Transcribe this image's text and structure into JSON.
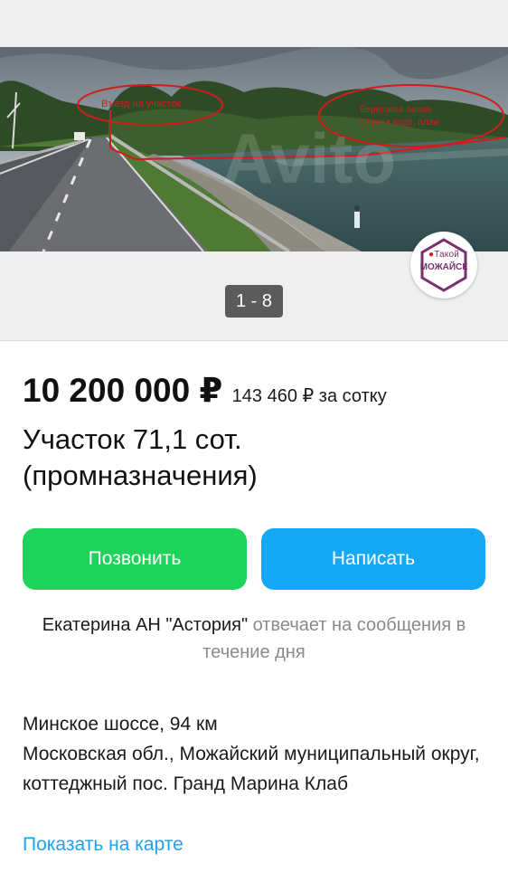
{
  "gallery": {
    "photo_annotations": {
      "left": "Въезд на участок",
      "right_line1": "Береговая линия",
      "right_line2": "Спуск к воде, пляж"
    },
    "watermark": "Avito",
    "badge": {
      "small": "Такой",
      "big": "МОЖАЙСК"
    },
    "counter": "1 - 8"
  },
  "listing": {
    "price": "10 200 000 ₽",
    "price_per_unit": "143 460 ₽ за сотку",
    "title": "Участок 71,1 сот. (промназначения)"
  },
  "actions": {
    "call_label": "Позвонить",
    "write_label": "Написать"
  },
  "seller": {
    "name": "Екатерина АН \"Астория\"",
    "note": "отвечает на сообщения в течение дня"
  },
  "address": {
    "line1": "Минское шоссе, 94 км",
    "line2": "Московская обл., Можайский муниципальный округ, коттеджный пос. Гранд Марина Клаб",
    "map_link": "Показать на карте"
  },
  "colors": {
    "call_button": "#1ed35a",
    "write_button": "#14a8f5",
    "link": "#1aa3ee",
    "badge_accent": "#7a2f6f"
  }
}
